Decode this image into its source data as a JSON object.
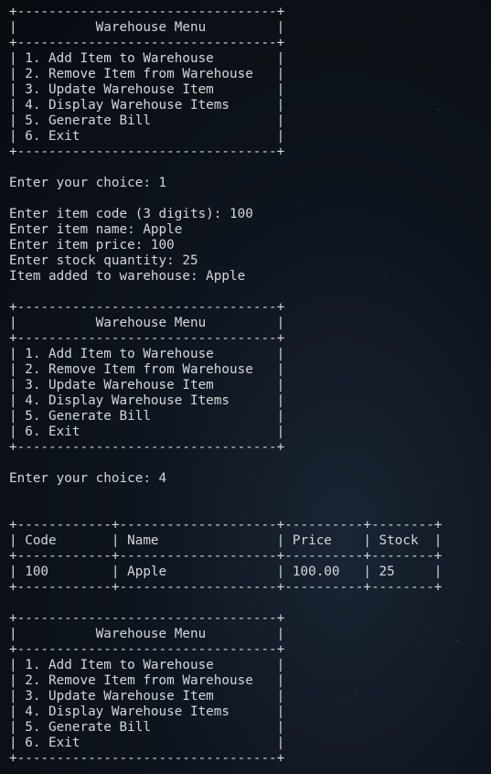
{
  "terminal": {
    "lines": [
      "+---------------------------------+",
      "|          Warehouse Menu         |",
      "+---------------------------------+",
      "| 1. Add Item to Warehouse        |",
      "| 2. Remove Item from Warehouse   |",
      "| 3. Update Warehouse Item        |",
      "| 4. Display Warehouse Items      |",
      "| 5. Generate Bill                |",
      "| 6. Exit                         |",
      "+---------------------------------+",
      "",
      "Enter your choice: 1",
      "",
      "Enter item code (3 digits): 100",
      "Enter item name: Apple",
      "Enter item price: 100",
      "Enter stock quantity: 25",
      "Item added to warehouse: Apple",
      "",
      "+---------------------------------+",
      "|          Warehouse Menu         |",
      "+---------------------------------+",
      "| 1. Add Item to Warehouse        |",
      "| 2. Remove Item from Warehouse   |",
      "| 3. Update Warehouse Item        |",
      "| 4. Display Warehouse Items      |",
      "| 5. Generate Bill                |",
      "| 6. Exit                         |",
      "+---------------------------------+",
      "",
      "Enter your choice: 4",
      "",
      "",
      "+------------+--------------------+----------+--------+",
      "| Code       | Name               | Price    | Stock  |",
      "+------------+--------------------+----------+--------+",
      "| 100        | Apple              | 100.00   | 25     |",
      "+------------+--------------------+----------+--------+",
      "",
      "+---------------------------------+",
      "|          Warehouse Menu         |",
      "+---------------------------------+",
      "| 1. Add Item to Warehouse        |",
      "| 2. Remove Item from Warehouse   |",
      "| 3. Update Warehouse Item        |",
      "| 4. Display Warehouse Items      |",
      "| 5. Generate Bill                |",
      "| 6. Exit                         |",
      "+---------------------------------+"
    ]
  }
}
